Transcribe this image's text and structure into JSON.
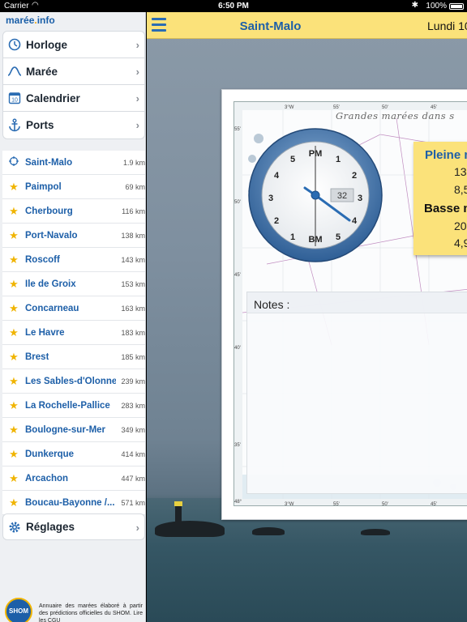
{
  "status_bar": {
    "carrier": "Carrier",
    "time": "6:50 PM",
    "battery": "100%"
  },
  "sidebar": {
    "logo": {
      "text_a": "marée",
      "text_b": "info"
    },
    "menu": [
      {
        "label": "Horloge",
        "icon": "clock-icon"
      },
      {
        "label": "Marée",
        "icon": "tide-wave-icon"
      },
      {
        "label": "Calendrier",
        "icon": "calendar-icon",
        "icon_text": "10"
      },
      {
        "label": "Ports",
        "icon": "anchor-icon"
      }
    ],
    "ports": [
      {
        "name": "Saint-Malo",
        "distance": "1.9 km",
        "icon": "location-icon"
      },
      {
        "name": "Paimpol",
        "distance": "69 km",
        "icon": "star-icon"
      },
      {
        "name": "Cherbourg",
        "distance": "116 km",
        "icon": "star-icon"
      },
      {
        "name": "Port-Navalo",
        "distance": "138 km",
        "icon": "star-icon"
      },
      {
        "name": "Roscoff",
        "distance": "143 km",
        "icon": "star-icon"
      },
      {
        "name": "Ile de Groix",
        "distance": "153 km",
        "icon": "star-icon"
      },
      {
        "name": "Concarneau",
        "distance": "163 km",
        "icon": "star-icon"
      },
      {
        "name": "Le Havre",
        "distance": "183 km",
        "icon": "star-icon"
      },
      {
        "name": "Brest",
        "distance": "185 km",
        "icon": "star-icon"
      },
      {
        "name": "Les Sables-d'Olonne",
        "distance": "239 km",
        "icon": "star-icon"
      },
      {
        "name": "La Rochelle-Pallice",
        "distance": "283 km",
        "icon": "star-icon"
      },
      {
        "name": "Boulogne-sur-Mer",
        "distance": "349 km",
        "icon": "star-icon"
      },
      {
        "name": "Dunkerque",
        "distance": "414 km",
        "icon": "star-icon"
      },
      {
        "name": "Arcachon",
        "distance": "447 km",
        "icon": "star-icon"
      },
      {
        "name": "Boucau-Bayonne /...",
        "distance": "571 km",
        "icon": "star-icon"
      }
    ],
    "settings_label": "Réglages",
    "shom_logo_text": "SHOM",
    "footer_text": "Annuaire des marées élaboré à partir des prédictions officielles du SHOM. Lire les CGU"
  },
  "header": {
    "title": "Saint-Malo",
    "date": "Lundi 10"
  },
  "chart_card": {
    "map_title": "Grandes marées dans s",
    "notes_label": "Notes :",
    "longitude_ticks": [
      "3°W",
      "55'",
      "50'",
      "45'"
    ],
    "latitude_ticks": [
      "55'",
      "50'",
      "45'",
      "40'",
      "35'",
      "48°"
    ]
  },
  "clock": {
    "pm_label": "PM",
    "bm_label": "BM",
    "numbers_right": [
      "1",
      "2",
      "3",
      "4",
      "5"
    ],
    "numbers_left": [
      "5",
      "4",
      "3",
      "2",
      "1"
    ],
    "day_window": "32"
  },
  "tide_note": {
    "high_label": "Pleine m",
    "high_time": "13",
    "high_height": "8,5",
    "low_label": "Basse m",
    "low_time": "20",
    "low_height": "4,9"
  }
}
